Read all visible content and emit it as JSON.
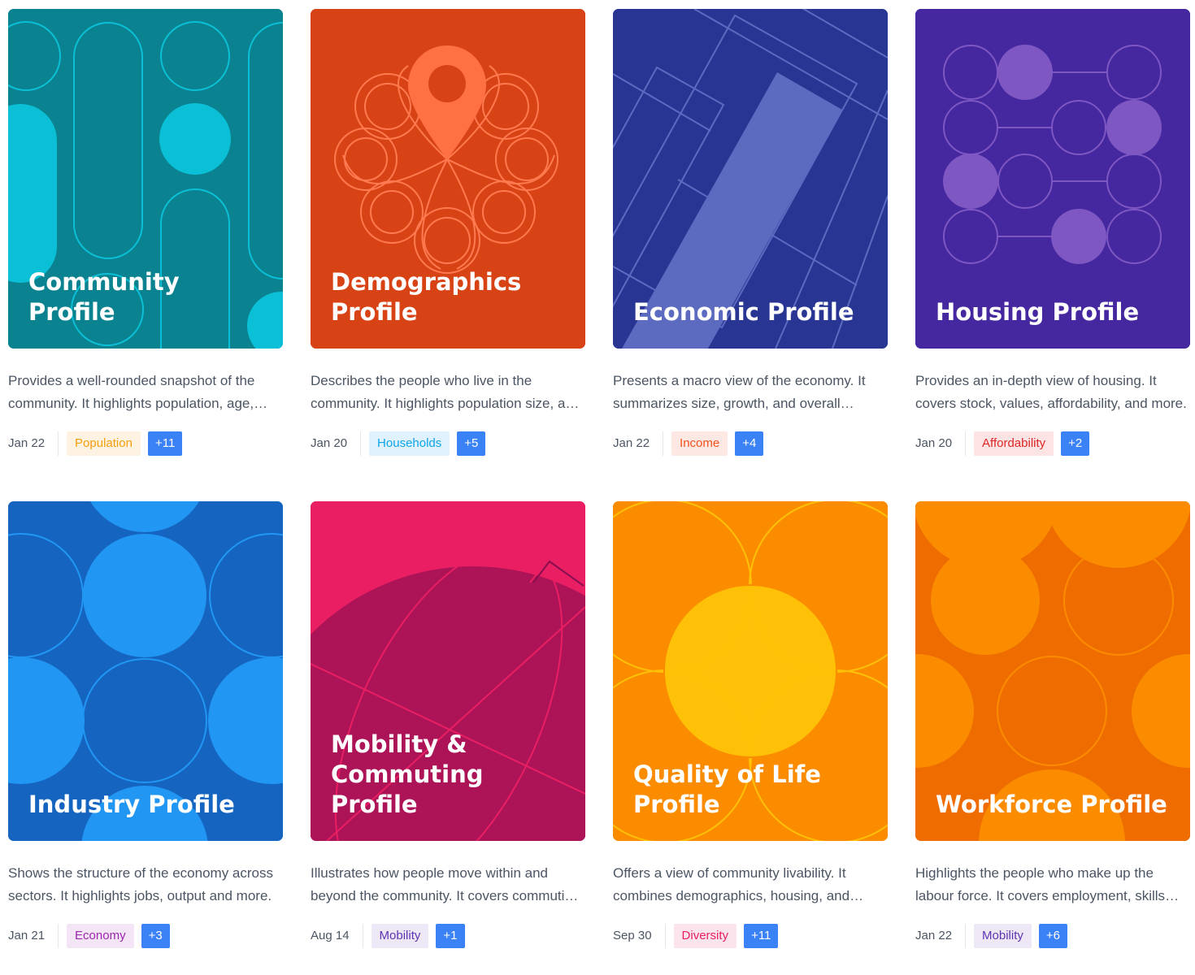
{
  "cards": [
    {
      "title": "Community Profile",
      "description": "Provides a well-rounded snapshot of the community. It highlights population, age, households and more.",
      "date": "Jan 22",
      "tag": "Population",
      "tag_bg": "#fef3e2",
      "tag_fg": "#f59e0b",
      "more": "+11",
      "more_bg": "#3b82f6",
      "bg": "#0a8290"
    },
    {
      "title": "Demographics Profile",
      "description": "Describes the people who live in the community. It highlights population size, age and more.",
      "date": "Jan 20",
      "tag": "Households",
      "tag_bg": "#e0f2fe",
      "tag_fg": "#0ea5e9",
      "more": "+5",
      "more_bg": "#3b82f6",
      "bg": "#d84315"
    },
    {
      "title": "Economic Profile",
      "description": "Presents a macro view of the economy. It summarizes size, growth, and overall performance.",
      "date": "Jan 22",
      "tag": "Income",
      "tag_bg": "#fde8e4",
      "tag_fg": "#f4511e",
      "more": "+4",
      "more_bg": "#3b82f6",
      "bg": "#283593"
    },
    {
      "title": "Housing Profile",
      "description": "Provides an in-depth view of housing. It covers stock, values, affordability, and more.",
      "date": "Jan 20",
      "tag": "Affordability",
      "tag_bg": "#fde4e4",
      "tag_fg": "#dc2626",
      "more": "+2",
      "more_bg": "#3b82f6",
      "bg": "#4527a0"
    },
    {
      "title": "Industry Profile",
      "description": "Shows the structure of the economy across sectors. It highlights jobs, output and more.",
      "date": "Jan 21",
      "tag": "Economy",
      "tag_bg": "#f3e5f5",
      "tag_fg": "#9c27b0",
      "more": "+3",
      "more_bg": "#3b82f6",
      "bg": "#1565c0"
    },
    {
      "title": "Mobility & Commuting Profile",
      "description": "Illustrates how people move within and beyond the community. It covers commuting and more.",
      "date": "Aug 14",
      "tag": "Mobility",
      "tag_bg": "#ede7f6",
      "tag_fg": "#5e35b1",
      "more": "+1",
      "more_bg": "#3b82f6",
      "bg": "#ad1457"
    },
    {
      "title": "Quality of Life Profile",
      "description": "Offers a view of community livability. It combines demographics, housing, and more.",
      "date": "Sep 30",
      "tag": "Diversity",
      "tag_bg": "#fce4ec",
      "tag_fg": "#e91e63",
      "more": "+11",
      "more_bg": "#3b82f6",
      "bg": "#fb8c00"
    },
    {
      "title": "Workforce Profile",
      "description": "Highlights the people who make up the labour force. It covers employment, skills and more.",
      "date": "Jan 22",
      "tag": "Mobility",
      "tag_bg": "#ede7f6",
      "tag_fg": "#5e35b1",
      "more": "+6",
      "more_bg": "#3b82f6",
      "bg": "#ef6c00"
    }
  ]
}
